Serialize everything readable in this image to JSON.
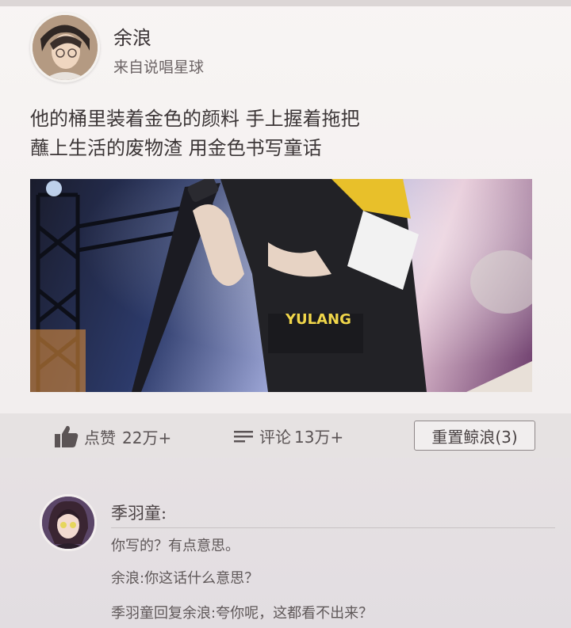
{
  "post": {
    "author": "余浪",
    "source": "来自说唱星球",
    "text_lines": [
      "他的桶里装着金色的颜料 手上握着拖把",
      "蘸上生活的废物渣 用金色书写童话"
    ],
    "image_caption": "YULANG"
  },
  "actions": {
    "like_label": "点赞",
    "like_count": "22万+",
    "comment_label": "评论",
    "comment_count": "13万+",
    "reset_button": "重置鲸浪(3)"
  },
  "comment": {
    "name": "季羽童:",
    "lines": [
      "你写的？有点意思。",
      "余浪:你这话什么意思？",
      "季羽童回复余浪:夸你呢，这都看不出来？"
    ]
  },
  "icons": [
    "thumbs-up-icon",
    "comment-lines-icon"
  ]
}
